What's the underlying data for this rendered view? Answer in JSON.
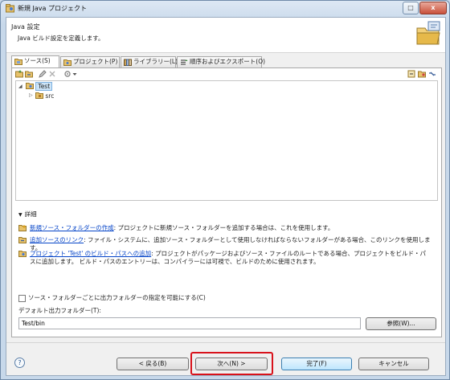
{
  "window": {
    "title": "新規 Java プロジェクト",
    "max_glyph": "□",
    "close_glyph": "x"
  },
  "banner": {
    "title": "Java 設定",
    "description": "Java ビルド設定を定義します。"
  },
  "tabs": [
    {
      "label": "ソース(S)",
      "icon": "source-folder-icon",
      "active": true
    },
    {
      "label": "プロジェクト(P)",
      "icon": "project-icon",
      "active": false
    },
    {
      "label": "ライブラリー(L)",
      "icon": "library-icon",
      "active": false
    },
    {
      "label": "順序およびエクスポート(O)",
      "icon": "order-export-icon",
      "active": false
    }
  ],
  "tree": {
    "project": "Test",
    "folder": "src"
  },
  "details": {
    "header": "詳細",
    "items": [
      {
        "link": "新規ソース・フォルダーの作成",
        "text": ": プロジェクトに新規ソース・フォルダーを追加する場合は、これを使用します。"
      },
      {
        "link": "追加ソースのリンク",
        "text": ": ファイル・システムに、追加ソース・フォルダーとして使用しなければならないフォルダーがある場合、このリンクを使用します。"
      },
      {
        "link": "プロジェクト 'Test' のビルド・パスへの追加",
        "text": ": プロジェクトがパッケージおよびソース・ファイルのルートである場合、プロジェクトをビルド・パスに追加します。 ビルド・パスのエントリーは、コンパイラーには可視で、ビルドのために使用されます。"
      }
    ]
  },
  "output": {
    "checkbox_label": "ソース・フォルダーごとに出力フォルダーの指定を可能にする(C)",
    "checkbox_checked": false,
    "folder_label": "デフォルト出力フォルダー(T):",
    "folder_value": "Test/bin",
    "browse_label": "参照(W)..."
  },
  "buttons": {
    "help": "?",
    "back": "< 戻る(B)",
    "next": "次へ(N) >",
    "finish": "完了(F)",
    "cancel": "キャンセル"
  },
  "colors": {
    "highlight": "#d8121b",
    "link": "#0645c8",
    "selection": "#cde4f7"
  }
}
